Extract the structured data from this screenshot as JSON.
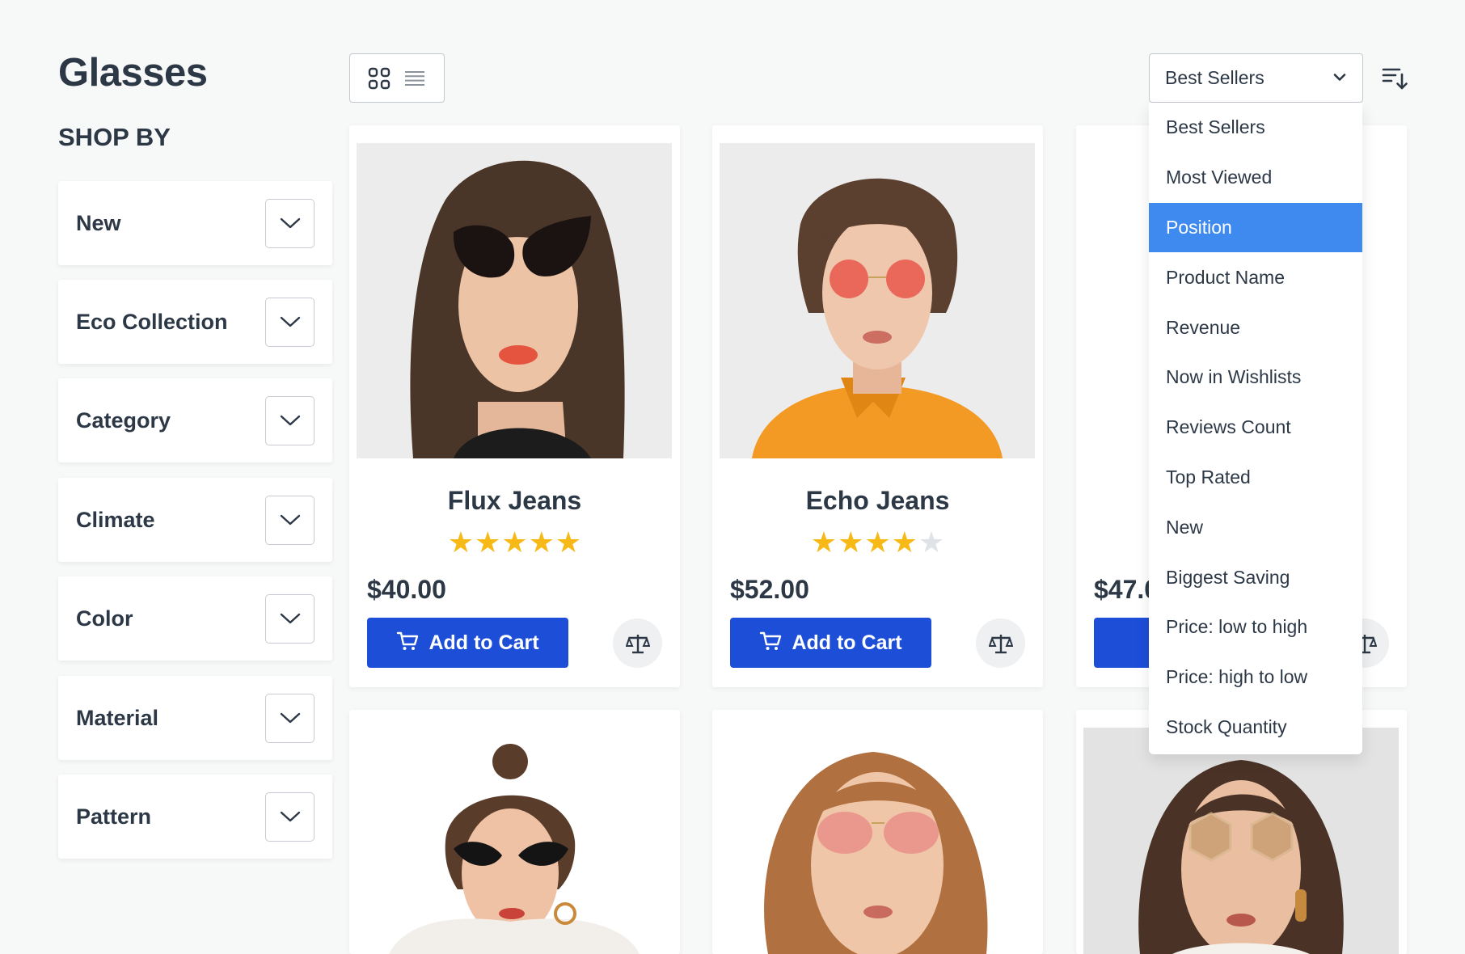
{
  "page": {
    "title": "Glasses"
  },
  "sidebar": {
    "heading": "SHOP BY",
    "filters": [
      {
        "label": "New"
      },
      {
        "label": "Eco Collection"
      },
      {
        "label": "Category"
      },
      {
        "label": "Climate"
      },
      {
        "label": "Color"
      },
      {
        "label": "Material"
      },
      {
        "label": "Pattern"
      }
    ]
  },
  "toolbar": {
    "view_modes": [
      {
        "icon": "grid-view-icon"
      },
      {
        "icon": "list-view-icon"
      }
    ],
    "sort": {
      "selected": "Best Sellers",
      "direction_icon": "sort-descending-icon",
      "options": [
        "Best Sellers",
        "Most Viewed",
        "Position",
        "Product Name",
        "Revenue",
        "Now in Wishlists",
        "Reviews Count",
        "Top Rated",
        "New",
        "Biggest Saving",
        "Price: low to high",
        "Price: high to low",
        "Stock Quantity"
      ],
      "highlighted": "Position"
    }
  },
  "products": [
    {
      "name": "Flux Jeans",
      "rating": 5,
      "max_rating": 5,
      "price": "$40.00",
      "add_label": "Add to Cart"
    },
    {
      "name": "Echo Jeans",
      "rating": 4,
      "max_rating": 5,
      "price": "$52.00",
      "add_label": "Add to Cart"
    },
    {
      "name": "",
      "rating": 0,
      "max_rating": 5,
      "price": "$47.0",
      "add_label": ""
    },
    {
      "name": "",
      "price": "",
      "add_label": ""
    },
    {
      "name": "",
      "price": "",
      "add_label": ""
    },
    {
      "name": "",
      "price": "",
      "add_label": ""
    }
  ],
  "colors": {
    "accent": "#1d4ed8",
    "dropdown_highlight": "#3f8aee",
    "star_filled": "#f7b916",
    "star_empty": "#dfe3e8",
    "text": "#2d3846",
    "background": "#f7f8f8"
  }
}
